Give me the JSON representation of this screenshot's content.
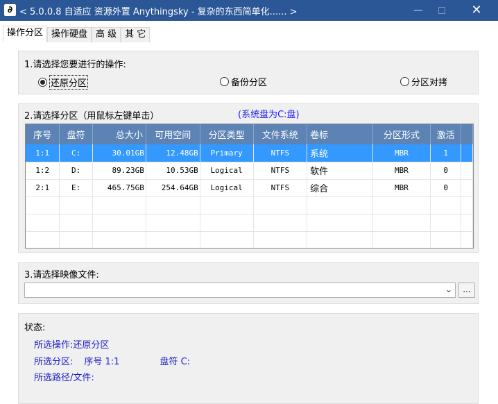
{
  "window": {
    "title": "< 5.0.0.8 自适应 资源外置 Anythingsky - 复杂的东西简单化...... >",
    "app_icon_glyph": "∂",
    "minimize": "—",
    "close": "✕",
    "titlebar_color": "#2b5797"
  },
  "tabs": [
    {
      "label": "操作分区"
    },
    {
      "label": "操作硬盘"
    },
    {
      "label": "高 级"
    },
    {
      "label": "其 它"
    }
  ],
  "operation": {
    "title": "1.请选择您要进行的操作:",
    "options": [
      {
        "label": "还原分区",
        "checked": true
      },
      {
        "label": "备份分区",
        "checked": false
      },
      {
        "label": "分区对拷",
        "checked": false
      }
    ]
  },
  "partition": {
    "title": "2.请选择分区（用鼠标左键单击）",
    "hint": "(系统盘为C:盘)",
    "hint_color": "#1a1aff",
    "columns": [
      "序号",
      "盘符",
      "总大小",
      "可用空间",
      "分区类型",
      "文件系统",
      "卷标",
      "分区形式",
      "激活"
    ],
    "rows": [
      {
        "no": "1:1",
        "drive": "C:",
        "total": "30.01GB",
        "free": "12.48GB",
        "type": "Primary",
        "fs": "NTFS",
        "label": "系统",
        "style": "MBR",
        "active": "1"
      },
      {
        "no": "1:2",
        "drive": "D:",
        "total": "89.23GB",
        "free": "10.53GB",
        "type": "Logical",
        "fs": "NTFS",
        "label": "软件",
        "style": "MBR",
        "active": "0"
      },
      {
        "no": "2:1",
        "drive": "E:",
        "total": "465.75GB",
        "free": "254.64GB",
        "type": "Logical",
        "fs": "NTFS",
        "label": "综合",
        "style": "MBR",
        "active": "0"
      }
    ],
    "selected_color": "#3399ff",
    "header_color": "#5c83b4"
  },
  "image_file": {
    "title": "3.请选择映像文件:",
    "value": "",
    "dropdown_icon": "chevron-down-icon",
    "browse_label": "..."
  },
  "status": {
    "label": "状态:",
    "op_label": "所选操作:",
    "op_value": "还原分区",
    "part_label": "所选分区:",
    "part_no_label": "序号 1:1",
    "part_drive_label": "盘符 C:",
    "path_label": "所选路径/文件:",
    "text_color": "#1a1acc"
  }
}
